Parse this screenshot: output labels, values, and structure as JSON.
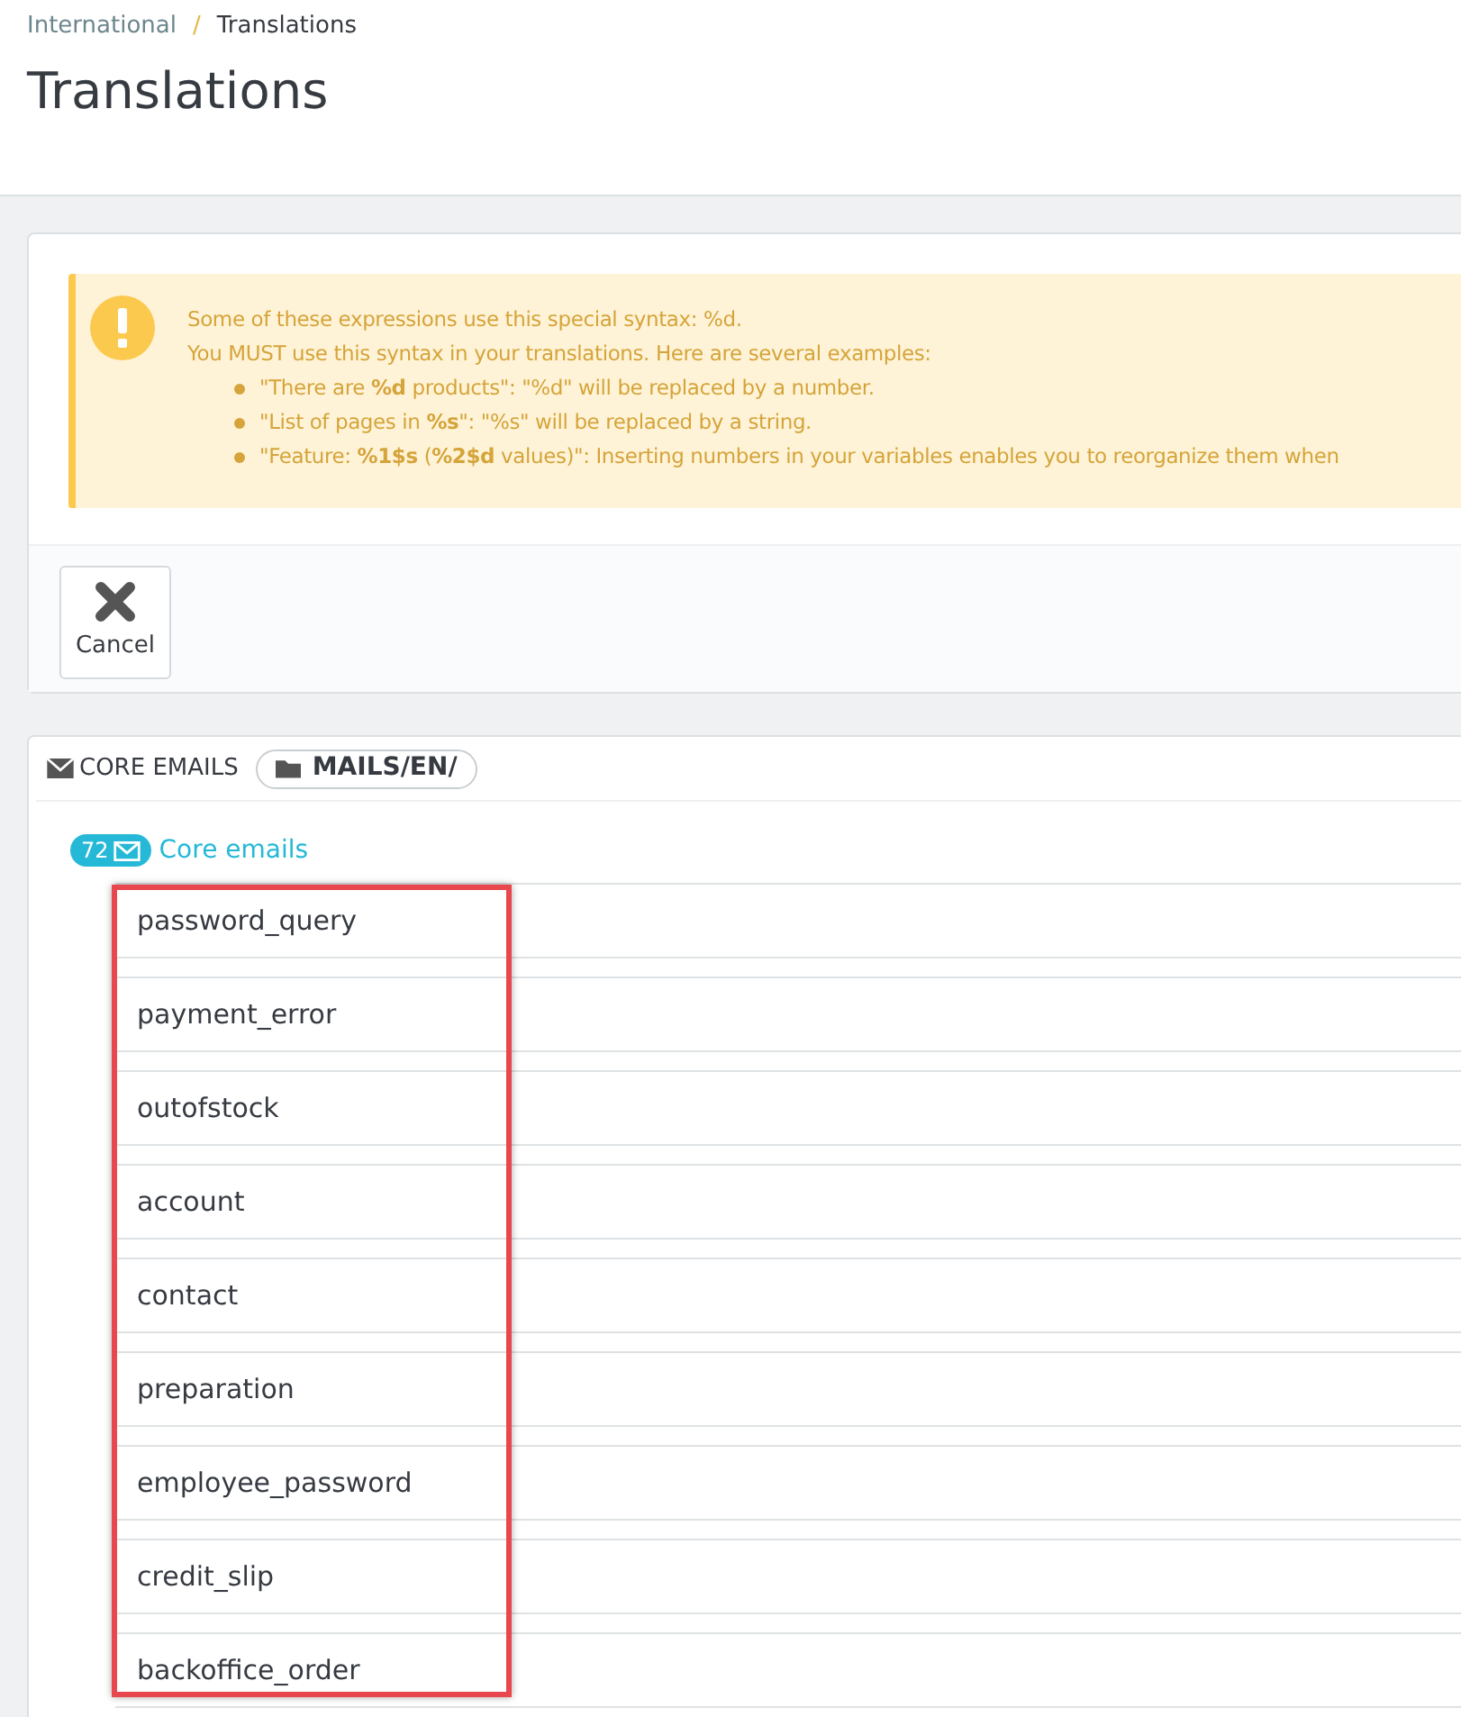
{
  "breadcrumb": [
    {
      "label": "International",
      "current": false
    },
    {
      "label": "Translations",
      "current": true
    }
  ],
  "breadcrumb_separator": "/",
  "page_title": "Translations",
  "alert": {
    "lines": [
      "Some of these expressions use this special syntax: %d.",
      "You MUST use this syntax in your translations. Here are several examples:"
    ],
    "bullets": [
      "\"There are **%d** products\": \"%d\" will be replaced by a number.",
      "\"List of pages in **%s**\": \"%s\" will be replaced by a string.",
      "\"Feature: **%1$s** (**%2$d** values)\": Inserting numbers in your variables enables you to reorganize them when"
    ]
  },
  "toolbar": {
    "buttons": [
      "Cancel"
    ]
  },
  "section": {
    "title": "CORE EMAILS",
    "path": "MAILS/EN/",
    "count": "72",
    "group": "Core emails",
    "items": [
      {
        "name": "password_query"
      },
      {
        "name": "payment_error"
      },
      {
        "name": "outofstock"
      },
      {
        "name": "account"
      },
      {
        "name": "contact"
      },
      {
        "name": "preparation"
      },
      {
        "name": "employee_password"
      },
      {
        "name": "credit_slip"
      },
      {
        "name": "backoffice_order"
      }
    ]
  }
}
